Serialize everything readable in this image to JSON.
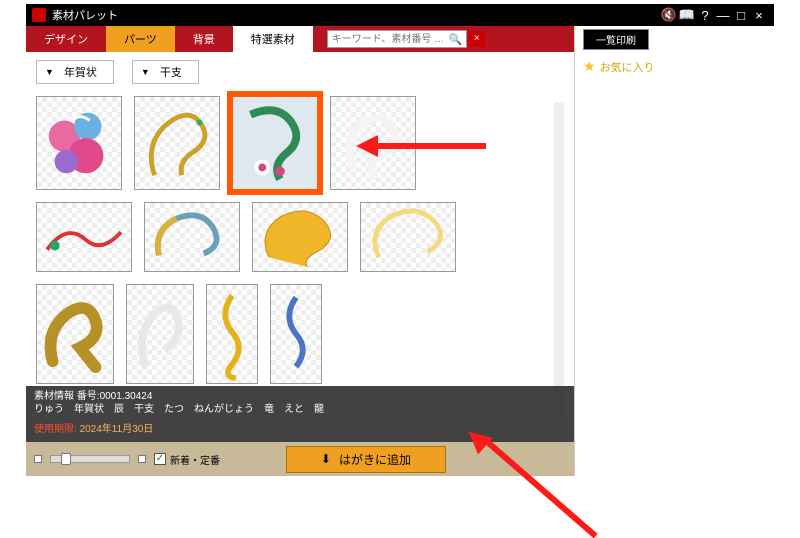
{
  "window": {
    "title": "素材パレット"
  },
  "titlebar_icons": {
    "mute": "🔇",
    "book": "📖",
    "help": "?",
    "min": "—",
    "max": "□",
    "close": "×"
  },
  "tabs": {
    "design": "デザイン",
    "parts": "パーツ",
    "background": "背景",
    "special": "特選素材"
  },
  "search": {
    "placeholder": "キーワード、素材番号 …",
    "clear": "×"
  },
  "toolbar": {
    "print_list": "一覧印刷"
  },
  "filters": {
    "category": "年賀状",
    "zodiac": "干支"
  },
  "info": {
    "number_label": "素材情報 番号:",
    "number": "0001.30424",
    "tags": "りゅう　年賀状　辰　干支　たつ　ねんがじょう　竜　えと　龍",
    "expire_label": "使用期限:",
    "expire_date": "2024年11月30日"
  },
  "bottom": {
    "checkbox_label": "新着・定番",
    "add_button": "はがきに追加",
    "download_icon": "⬇"
  },
  "favorites": {
    "title": "お気に入り"
  }
}
